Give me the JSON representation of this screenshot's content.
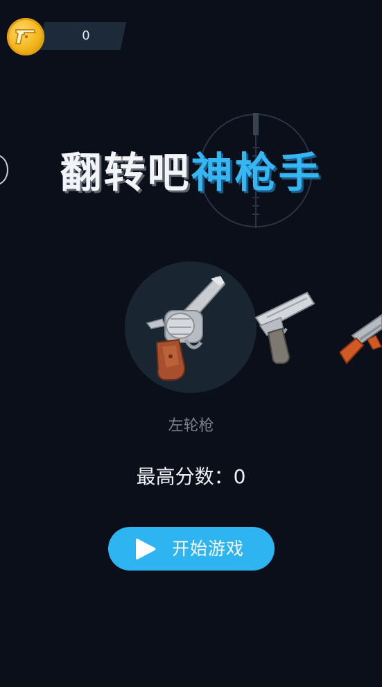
{
  "header": {
    "coin_icon": "pistol-coin-icon",
    "coin_count": "0"
  },
  "title": {
    "part_white": "翻转吧",
    "part_blue": "神枪手"
  },
  "weapons": {
    "selected_name": "左轮枪",
    "items": [
      "revolver-icon",
      "desert-eagle-icon",
      "ak-rifle-icon"
    ]
  },
  "score": {
    "text": "最高分数：0"
  },
  "start_button": {
    "icon": "play-icon",
    "label": "开始游戏"
  },
  "colors": {
    "background": "#0a0f1a",
    "accent": "#2eb4f0",
    "title_blue": "#36b6f3"
  }
}
